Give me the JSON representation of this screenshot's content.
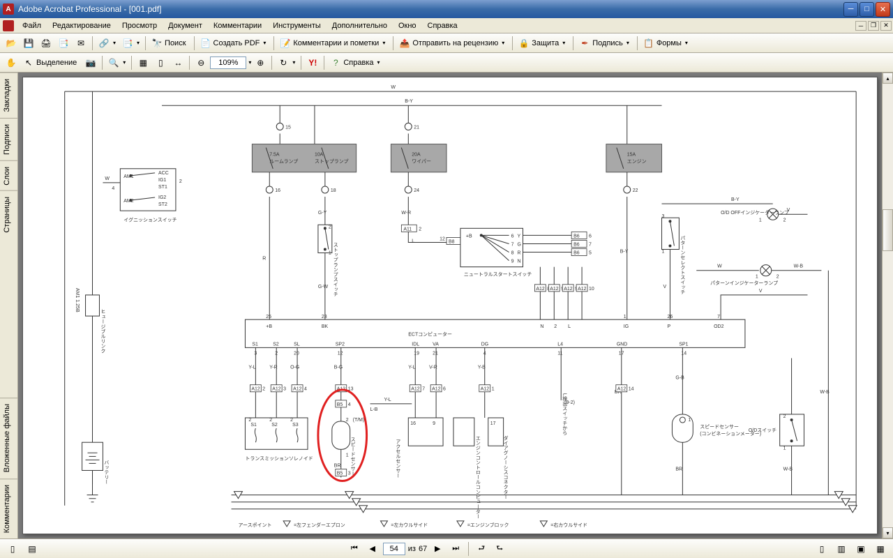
{
  "app": {
    "title": "Adobe Acrobat Professional - [001.pdf]"
  },
  "menu": {
    "items": [
      "Файл",
      "Редактирование",
      "Просмотр",
      "Документ",
      "Комментарии",
      "Инструменты",
      "Дополнительно",
      "Окно",
      "Справка"
    ]
  },
  "toolbar1": {
    "search": "Поиск",
    "create_pdf": "Создать PDF",
    "comments": "Комментарии и пометки",
    "send_review": "Отправить на рецензию",
    "security": "Защита",
    "sign": "Подпись",
    "forms": "Формы"
  },
  "toolbar2": {
    "selection": "Выделение",
    "zoom": "109%",
    "help": "Справка"
  },
  "tabs": {
    "bookmarks": "Закладки",
    "signatures": "Подписи",
    "layers": "Слои",
    "pages": "Страницы",
    "attachments": "Вложенные файлы",
    "comments": "Комментарии"
  },
  "pagenav": {
    "current": "54",
    "of_label": "из",
    "total": "67"
  },
  "diagram": {
    "wires": {
      "w": "W",
      "by": "B-Y",
      "r": "R",
      "gy": "G-Y",
      "wr": "W-R",
      "v": "V",
      "wb": "W-B",
      "y": "Y",
      "g": "G",
      "l": "L",
      "br": "BR",
      "gw": "G-W",
      "yl": "Y-L",
      "yr": "Y-R",
      "og": "O-G",
      "bg": "B-G",
      "vr": "V-R",
      "yb": "Y-B",
      "lb": "L-B",
      "gb": "G-B"
    },
    "fuses": {
      "f1": {
        "amp": "7.5A",
        "name": "ルームランプ"
      },
      "f2": {
        "amp": "10A",
        "name": "ストップランプ"
      },
      "f3": {
        "amp": "20A",
        "name": "ワイパー"
      },
      "f4": {
        "amp": "15A",
        "name": "エンジン"
      }
    },
    "ignition": {
      "label": "イグニッションスイッチ",
      "am1": "AM1",
      "am2": "AM2",
      "acc": "ACC",
      "ig1": "IG1",
      "st1": "ST1",
      "ig2": "IG2",
      "st2": "ST2"
    },
    "battery": {
      "label": "バッテリー",
      "am1_25b": "AM1 1.25B",
      "fusible": "ヒュージブルリンク"
    },
    "neutral_sw": {
      "label": "ニュートラルスタートスイッチ",
      "b": "+B",
      "l": "L",
      "g": "G",
      "r": "R",
      "n": "N"
    },
    "ect": {
      "label": "ECTコンピューター",
      "pins_top": {
        "p25": "25",
        "p23": "23",
        "p1": "1",
        "p26": "26",
        "p7": "7"
      },
      "names_top": {
        "pb": "+B",
        "bk": "BK",
        "n": "N",
        "two": "2",
        "l2": "L",
        "ig": "IG",
        "p": "P",
        "od2": "OD2"
      },
      "pins_bot": {
        "p3": "3",
        "p2": "2",
        "p20": "20",
        "p12": "12",
        "p19": "19",
        "p21": "21",
        "p4": "4",
        "p11": "11",
        "p17": "17",
        "p14": "14"
      },
      "names_bot": {
        "s1": "S1",
        "s2": "S2",
        "sl": "SL",
        "sp2": "SP2",
        "idl": "IDL",
        "va": "VA",
        "dg": "DG",
        "l4": "L4",
        "gnd": "GND",
        "sp1": "SP1"
      }
    },
    "components": {
      "stop_sw": "ストップランプスイッチ",
      "pattern_sw": "パターンセレクトスイッチ",
      "od_off": "O/D OFFインジケーターランプ",
      "pattern_ind": "パターンインジケーターランプ",
      "trans_sol": "トランスミッションソレノイド",
      "speed_tm": "スピードセンサー",
      "tm_suffix": "(T/M)",
      "accel": "アクセルセンサー",
      "engine_ecu": "エンジンコントロールコンピューター",
      "diag": "ダイアグノーシスコネクター",
      "l_detect": "L検出スイッチから",
      "l_detect2": "(9-2)",
      "speed_combo": "スピードセンサー",
      "speed_combo2": "(コンビネーションメーター)",
      "od_sw": "O/Dスイッチ"
    },
    "sol": {
      "s1": "S1",
      "s2": "S2",
      "s3": "S3"
    },
    "earth": {
      "label": "アースポイント",
      "fender": "=左フェンダーエプロン",
      "cowl_l": "=左カウルサイド",
      "engine": "=エンジンブロック",
      "cowl_r": "=右カウルサイド"
    },
    "conn": {
      "c15": "15",
      "c21": "21",
      "c16": "16",
      "c18": "18",
      "c24": "24",
      "c22": "22",
      "c8": "8",
      "c9": "9",
      "c10": "10",
      "c2": "2",
      "c3": "3",
      "c4": "4",
      "c5": "5",
      "c6": "6",
      "c7": "7",
      "c12": "12",
      "c13": "13",
      "c14": "14",
      "c1": "1",
      "c17": "17",
      "c19": "19"
    },
    "refs": {
      "a11": "A11",
      "a12": "A12",
      "b5": "B5",
      "b6": "B6",
      "b8": "B8"
    }
  }
}
